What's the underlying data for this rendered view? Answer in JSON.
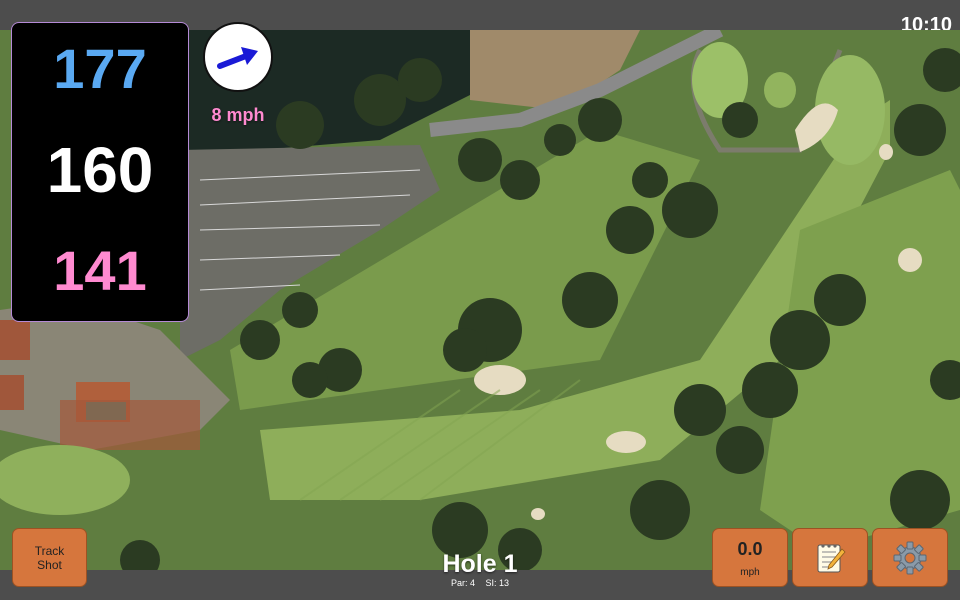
{
  "status": {
    "time": "10:10"
  },
  "yardage": {
    "back": "177",
    "middle": "160",
    "front": "141"
  },
  "wind": {
    "speed": "8 mph",
    "icon": "wind-arrow-icon"
  },
  "hole": {
    "title": "Hole 1",
    "par": "Par: 4",
    "si": "SI: 13"
  },
  "buttons": {
    "track_shot_line1": "Track",
    "track_shot_line2": "Shot",
    "speed_value": "0.0",
    "speed_unit": "mph",
    "notes_icon": "notepad-icon",
    "settings_icon": "gear-icon"
  },
  "colors": {
    "back_yardage": "#5aa9f2",
    "middle_yardage": "#ffffff",
    "front_yardage": "#ff8ad0",
    "button": "#d6763d"
  }
}
